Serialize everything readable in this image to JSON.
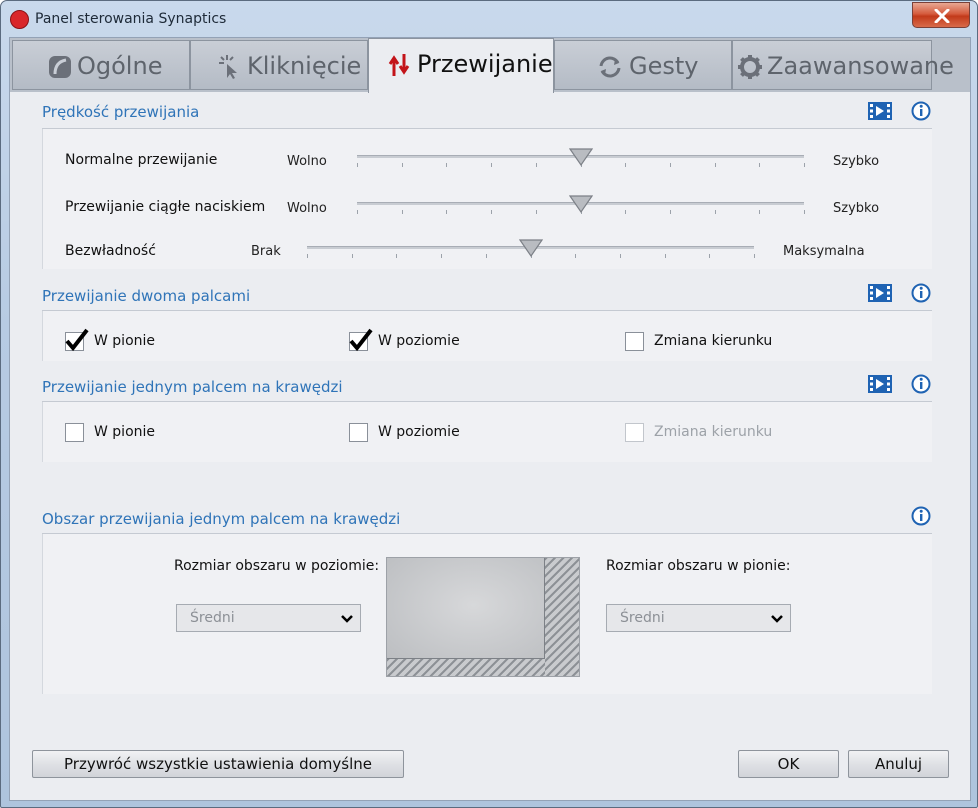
{
  "window": {
    "title": "Panel sterowania Synaptics"
  },
  "tabs": [
    {
      "label": "Ogólne",
      "icon": "touchpad-icon",
      "active": false
    },
    {
      "label": "Kliknięcie",
      "icon": "click-icon",
      "active": false
    },
    {
      "label": "Przewijanie",
      "icon": "scroll-arrows-icon",
      "active": true
    },
    {
      "label": "Gesty",
      "icon": "gesture-icon",
      "active": false
    },
    {
      "label": "Zaawansowane",
      "icon": "gear-icon",
      "active": false
    }
  ],
  "scroll_speed": {
    "title": "Prędkość przewijania",
    "normal": {
      "label": "Normalne przewijanie",
      "min_label": "Wolno",
      "max_label": "Szybko",
      "value": 0.5
    },
    "continuous": {
      "label": "Przewijanie ciągłe naciskiem",
      "min_label": "Wolno",
      "max_label": "Szybko",
      "value": 0.5
    },
    "inertia": {
      "label": "Bezwładność",
      "min_label": "Brak",
      "max_label": "Maksymalna",
      "value": 0.5
    }
  },
  "two_finger": {
    "title": "Przewijanie dwoma palcami",
    "vertical": {
      "label": "W pionie",
      "checked": true
    },
    "horizontal": {
      "label": "W poziomie",
      "checked": true
    },
    "reverse": {
      "label": "Zmiana kierunku",
      "checked": false
    }
  },
  "one_finger_edge": {
    "title": "Przewijanie jednym palcem na krawędzi",
    "vertical": {
      "label": "W pionie",
      "checked": false
    },
    "horizontal": {
      "label": "W poziomie",
      "checked": false
    },
    "reverse": {
      "label": "Zmiana kierunku",
      "checked": false,
      "disabled": true
    }
  },
  "edge_area": {
    "title": "Obszar przewijania jednym palcem na krawędzi",
    "horizontal_label": "Rozmiar obszaru w poziomie:",
    "horizontal_value": "Średni",
    "vertical_label": "Rozmiar obszaru w pionie:",
    "vertical_value": "Średni"
  },
  "footer": {
    "restore_label": "Przywróć wszystkie ustawienia domyślne",
    "ok_label": "OK",
    "cancel_label": "Anuluj"
  },
  "colors": {
    "section_title": "#2f74b8",
    "accent_red": "#d9262b",
    "info_blue": "#1f63b3"
  }
}
